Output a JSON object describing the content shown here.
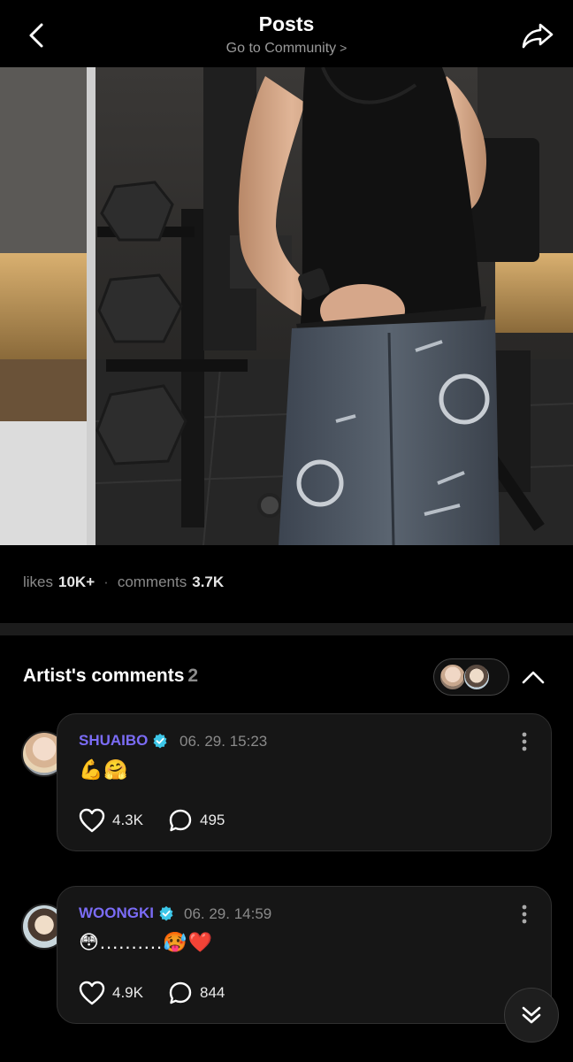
{
  "header": {
    "title": "Posts",
    "subtitle": "Go to Community",
    "subtitle_chevron": ">"
  },
  "stats": {
    "likes_label": "likes",
    "likes_value": "10K+",
    "separator": "·",
    "comments_label": "comments",
    "comments_value": "3.7K"
  },
  "artist_comments": {
    "title": "Artist's comments",
    "count": "2"
  },
  "comments": [
    {
      "name": "SHUAIBO",
      "time": "06. 29. 15:23",
      "body": "💪🤗",
      "likes": "4.3K",
      "replies": "495"
    },
    {
      "name": "WOONGKI",
      "time": "06. 29. 14:59",
      "body": "😳..........🥵❤️",
      "likes": "4.9K",
      "replies": "844"
    }
  ],
  "colors": {
    "background": "#000000",
    "card": "#161616",
    "artist_name": "#7b6cf6",
    "verified": "#3cc6e8"
  },
  "icons": {
    "back": "chevron-left-icon",
    "share": "share-arrow-icon",
    "more": "more-vertical-icon",
    "like": "heart-outline-icon",
    "reply": "chat-bubble-icon",
    "collapse": "chevron-up-icon",
    "scroll_down": "double-chevron-down-icon",
    "verified": "verified-badge-icon"
  }
}
